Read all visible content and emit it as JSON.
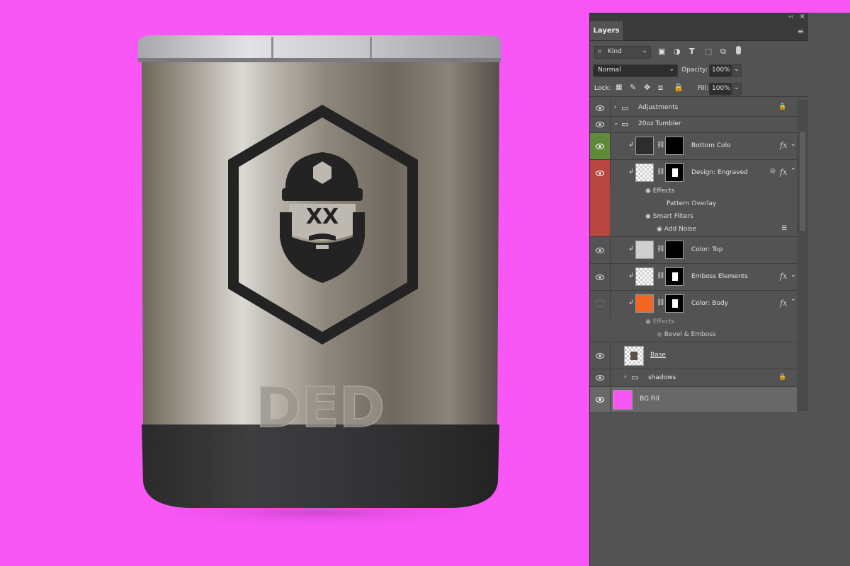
{
  "panel": {
    "tab_label": "Layers",
    "kind_label": "Kind",
    "blend_mode": "Normal",
    "opacity_label": "Opacity:",
    "opacity_value": "100%",
    "lock_label": "Lock:",
    "fill_label": "Fill:",
    "fill_value": "100%"
  },
  "layers": {
    "adjustments": "Adjustments",
    "tumbler_group": "20oz Tumbler",
    "bottom_color": "Bottom Colo",
    "design_engraved": "Design: Engraved",
    "effects_1": "Effects",
    "pattern_overlay": "Pattern Overlay",
    "smart_filters": "Smart Filters",
    "add_noise": "Add Noise",
    "color_top": "Color: Top",
    "emboss_elements": "Emboss Elements",
    "color_body": "Color: Body",
    "effects_2": "Effects",
    "bevel_emboss": "Bevel & Emboss",
    "base": "Base",
    "shadows": "shadows",
    "bg_fill": "BG Fill"
  },
  "canvas": {
    "embossed_text": "DED",
    "engraved_letters": "XX"
  },
  "colors": {
    "canvas_bg": "#f857f6",
    "panel_bg": "#535353",
    "visibility_green": "#5f8a3a",
    "visibility_red": "#b6463f",
    "color_body_swatch": "#f26522"
  }
}
